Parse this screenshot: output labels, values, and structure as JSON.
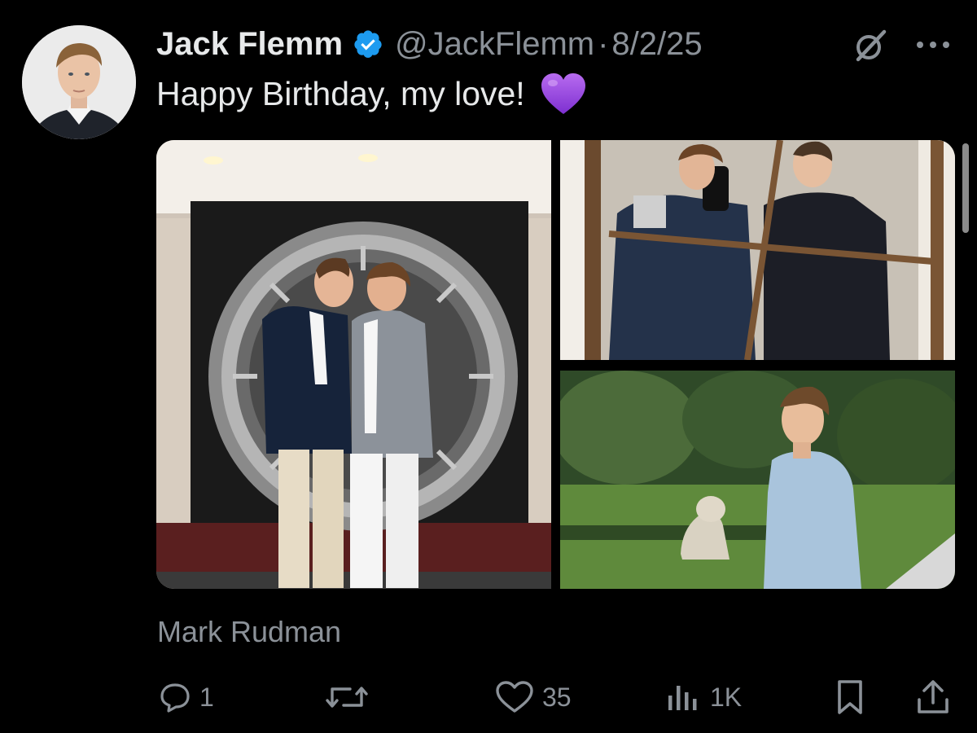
{
  "post": {
    "author_name": "Jack Flemm",
    "verified_icon": "verified-badge-icon",
    "handle": "@JackFlemm",
    "separator": "·",
    "date": "8/2/25",
    "text": "Happy Birthday, my love!",
    "emoji": "purple-heart-icon",
    "media_credit": "Mark Rudman"
  },
  "media": {
    "photos": [
      {
        "description_icon": "photo-couple-vault"
      },
      {
        "description_icon": "photo-mirror-selfie"
      },
      {
        "description_icon": "photo-garden-portrait"
      }
    ]
  },
  "actions": {
    "reply_count": "1",
    "repost_count": "",
    "like_count": "35",
    "views_count": "1K"
  },
  "colors": {
    "background": "#000000",
    "primary_text": "#e7e9ea",
    "secondary_text": "#8b9198",
    "verified_blue": "#1d9bf0",
    "emoji_purple": "#9b4de0"
  }
}
